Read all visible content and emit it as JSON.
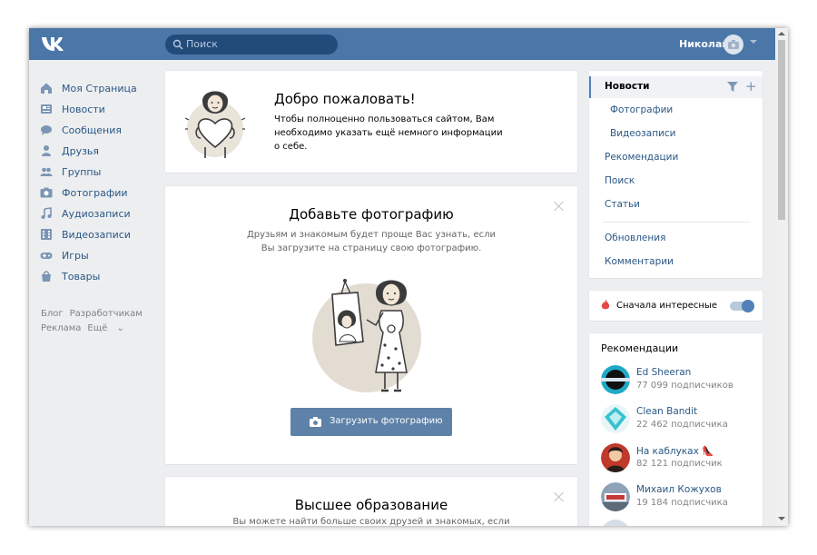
{
  "header": {
    "search_placeholder": "Поиск",
    "user_name": "Николай"
  },
  "sidebar": {
    "items": [
      {
        "label": "Моя Страница",
        "icon": "home-icon"
      },
      {
        "label": "Новости",
        "icon": "news-icon"
      },
      {
        "label": "Сообщения",
        "icon": "messages-icon"
      },
      {
        "label": "Друзья",
        "icon": "friends-icon"
      },
      {
        "label": "Группы",
        "icon": "groups-icon"
      },
      {
        "label": "Фотографии",
        "icon": "camera-icon"
      },
      {
        "label": "Аудиозаписи",
        "icon": "music-icon"
      },
      {
        "label": "Видеозаписи",
        "icon": "video-icon"
      },
      {
        "label": "Игры",
        "icon": "gamepad-icon"
      },
      {
        "label": "Товары",
        "icon": "shopping-bag-icon"
      }
    ],
    "footer": [
      "Блог",
      "Разработчикам",
      "Реклама",
      "Ещё"
    ]
  },
  "welcome": {
    "title": "Добро пожаловать!",
    "text": "Чтобы полноценно пользоваться сайтом, Вам необходимо указать ещё немного информации о себе."
  },
  "add_photo": {
    "title": "Добавьте фотографию",
    "text": "Друзьям и знакомым будет проще Вас узнать, если Вы загрузите на страницу свою фотографию.",
    "button": "Загрузить фотографию"
  },
  "education": {
    "title": "Высшее образование",
    "text": "Вы можете найти больше своих друзей и знакомых, если"
  },
  "right_menu": {
    "items": [
      {
        "label": "Новости",
        "active": true
      },
      {
        "label": "Фотографии",
        "sub": true
      },
      {
        "label": "Видеозаписи",
        "sub": true
      },
      {
        "label": "Рекомендации"
      },
      {
        "label": "Поиск"
      },
      {
        "label": "Статьи"
      },
      {
        "label": "Обновления"
      },
      {
        "label": "Комментарии"
      }
    ]
  },
  "interesting": {
    "label": "Сначала интересные",
    "enabled": true
  },
  "recommendations": {
    "title": "Рекомендации",
    "items": [
      {
        "name": "Ed Sheeran",
        "subs": "77 099 подписчиков"
      },
      {
        "name": "Clean Bandit",
        "subs": "22 462 подписчика"
      },
      {
        "name": "На каблуках 👠",
        "subs": "82 121 подписчик"
      },
      {
        "name": "Михаил Кожухов",
        "subs": "19 184 подписчика"
      }
    ]
  },
  "colors": {
    "header": "#4a76a8",
    "link": "#2a5885",
    "button": "#5e81a8",
    "background": "#edeef0"
  }
}
